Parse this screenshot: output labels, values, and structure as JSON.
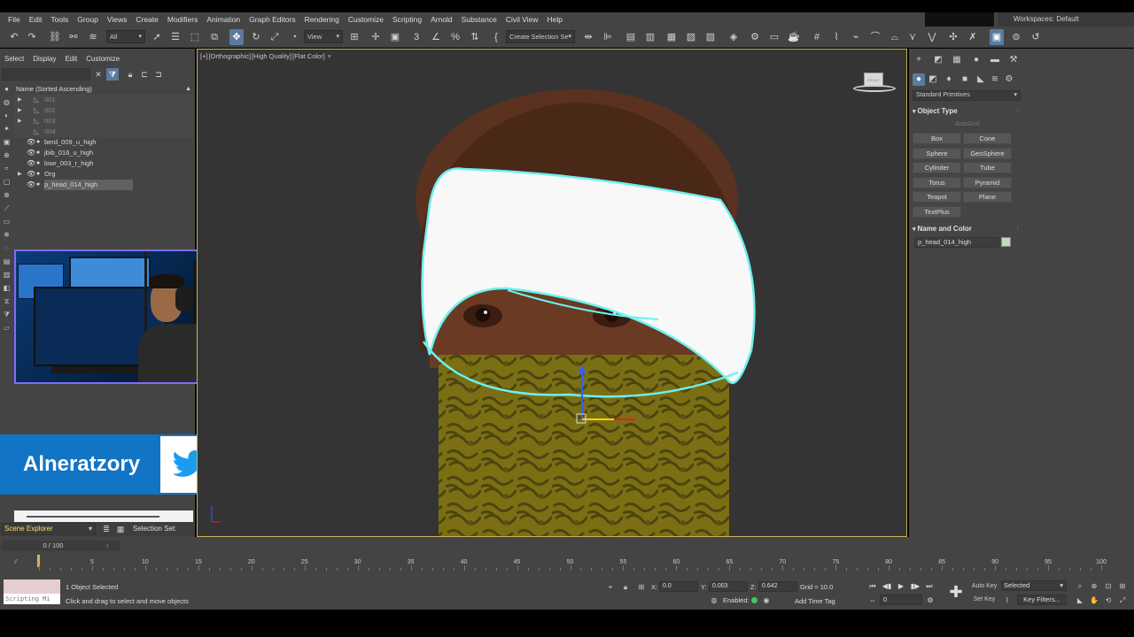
{
  "menu": [
    "File",
    "Edit",
    "Tools",
    "Group",
    "Views",
    "Create",
    "Modifiers",
    "Animation",
    "Graph Editors",
    "Rendering",
    "Customize",
    "Scripting",
    "Arnold",
    "Substance",
    "Civil View",
    "Help"
  ],
  "workspaces": {
    "label": "Workspaces:",
    "value": "Default"
  },
  "toolbar": {
    "filter_dropdown": "All",
    "view_dropdown": "View",
    "selection_set": "Create Selection Se"
  },
  "scene_explorer": {
    "menu": [
      "Select",
      "Display",
      "Edit",
      "Customize"
    ],
    "column_header": "Name (Sorted Ascending)",
    "sort_arrow": "▲",
    "rows": [
      {
        "label": "001",
        "kind": "layer",
        "has_arrow": true
      },
      {
        "label": "002",
        "kind": "layer",
        "has_arrow": true
      },
      {
        "label": "003",
        "kind": "layer",
        "has_arrow": true
      },
      {
        "label": "004",
        "kind": "layer",
        "has_arrow": false
      },
      {
        "label": "berd_009_u_high",
        "kind": "object",
        "has_arrow": false
      },
      {
        "label": "jbib_016_u_high",
        "kind": "object",
        "has_arrow": false
      },
      {
        "label": "lowr_003_r_high",
        "kind": "object",
        "has_arrow": false
      },
      {
        "label": "Org",
        "kind": "object",
        "has_arrow": true
      },
      {
        "label": "p_head_014_high",
        "kind": "object",
        "has_arrow": false,
        "selected": true
      }
    ],
    "footer_dropdown": "Scene Explorer",
    "selection_set_label": "Selection Set:"
  },
  "overlay": {
    "social_name": "Alneratzory",
    "social_icon": "twitter-bird-icon"
  },
  "viewport": {
    "labels": [
      "[+]",
      "[Orthographic]",
      "[High Quality]",
      "[Flat Color]"
    ],
    "filter_icon": "funnel-icon",
    "viewcube_label": "FRONT"
  },
  "command_panel": {
    "category_dropdown": "Standard Primitives",
    "object_type_title": "Object Type",
    "autogrid": "AutoGrid",
    "primitives": [
      "Box",
      "Cone",
      "Sphere",
      "GeoSphere",
      "Cylinder",
      "Tube",
      "Torus",
      "Pyramid",
      "Teapot",
      "Plane",
      "TextPlus"
    ],
    "name_and_color_title": "Name and Color",
    "object_name": "p_head_014_high",
    "object_color": "#b8e0b0"
  },
  "timeline": {
    "slider_label": "0 / 100",
    "current_frame": 0,
    "tick_labels": [
      0,
      5,
      10,
      15,
      20,
      25,
      30,
      35,
      40,
      45,
      50,
      55,
      60,
      65,
      70,
      75,
      80,
      85,
      90,
      95,
      100
    ]
  },
  "status": {
    "listener_text": "Scripting Mi",
    "objects_selected": "1 Object Selected",
    "prompt": "Click and drag to select and move objects",
    "x_label": "X:",
    "x_value": "0.0",
    "y_label": "Y:",
    "y_value": "0.003",
    "z_label": "Z:",
    "z_value": "0.642",
    "grid": "Grid = 10.0",
    "enabled": "Enabled:",
    "add_time_tag": "Add Time Tag",
    "frame": "0",
    "auto_key": "Auto Key",
    "set_key": "Set Key",
    "selected_dropdown": "Selected",
    "key_filters": "Key Filters..."
  }
}
